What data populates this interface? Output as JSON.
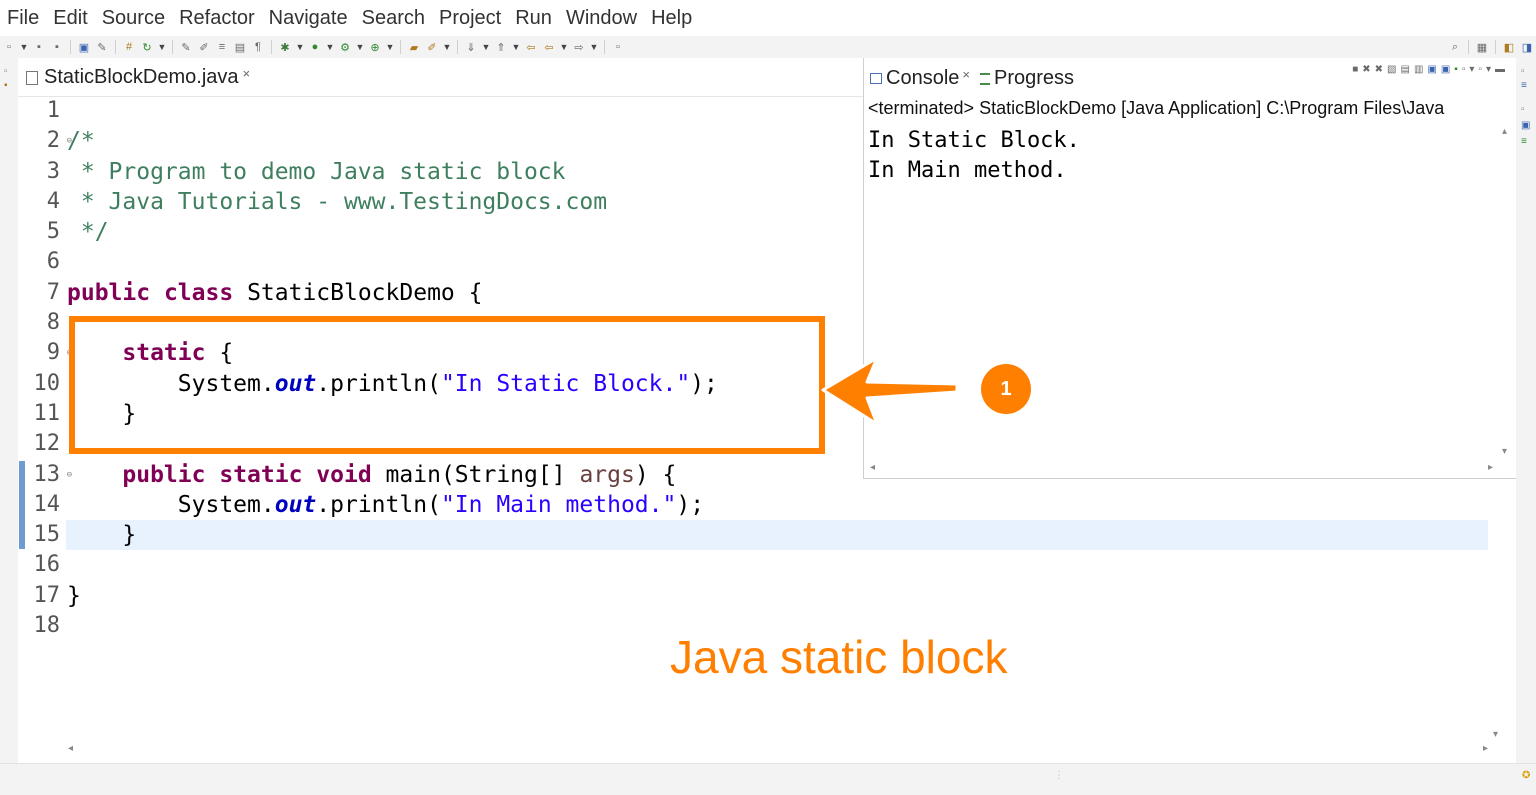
{
  "menu": [
    "File",
    "Edit",
    "Source",
    "Refactor",
    "Navigate",
    "Search",
    "Project",
    "Run",
    "Window",
    "Help"
  ],
  "editor": {
    "tab_label": "StaticBlockDemo.java",
    "tab_close": "×",
    "line_numbers": [
      "1",
      "2",
      "3",
      "4",
      "5",
      "6",
      "7",
      "8",
      "9",
      "10",
      "11",
      "12",
      "13",
      "14",
      "15",
      "16",
      "17",
      "18"
    ],
    "lines": [
      "",
      "/*",
      " * Program to demo Java static block",
      " * Java Tutorials - www.TestingDocs.com",
      " */",
      "",
      "public class StaticBlockDemo {",
      "",
      "    static {",
      "        System.out.println(\"In Static Block.\");",
      "    }",
      "",
      "    public static void main(String[] args) {",
      "        System.out.println(\"In Main method.\");",
      "    }",
      "",
      "}",
      ""
    ]
  },
  "console": {
    "tab_console": "Console",
    "tab_close": "×",
    "tab_progress": "Progress",
    "terminated": "<terminated> StaticBlockDemo [Java Application] C:\\Program Files\\Java",
    "output": [
      "In Static Block.",
      "In Main method."
    ]
  },
  "annotation": {
    "badge": "1",
    "caption": "Java static block",
    "color": "#ff7f00"
  }
}
